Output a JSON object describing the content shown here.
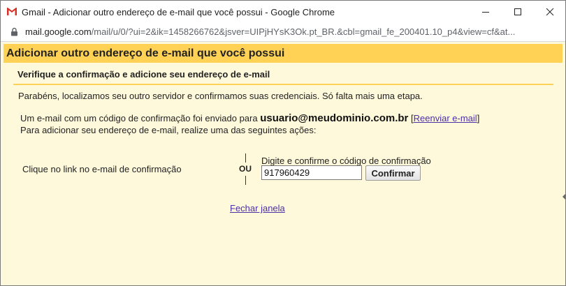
{
  "window": {
    "title": "Gmail - Adicionar outro endereço de e-mail que você possui - Google Chrome",
    "url_host": "mail.google.com",
    "url_path": "/mail/u/0/?ui=2&ik=1458266762&jsver=UIPjHYsK3Ok.pt_BR.&cbl=gmail_fe_200401.10_p4&view=cf&at..."
  },
  "icons": {
    "app": "gmail-icon",
    "lock": "lock-icon",
    "minimize": "minimize-icon",
    "maximize": "maximize-icon",
    "close": "close-icon"
  },
  "page": {
    "title": "Adicionar outro endereço de e-mail que você possui",
    "subtitle": "Verifique a confirmação e adicione seu endereço de e-mail",
    "success_text": "Parabéns, localizamos seu outro servidor e confirmamos suas credenciais. Só falta mais uma etapa.",
    "sent_text": "Um e-mail com um código de confirmação foi enviado para",
    "email": "usuario@meudominio.com.br",
    "resend_open": "[",
    "resend_link": "Reenviar e-mail",
    "resend_close": "]",
    "instructions": "Para adicionar seu endereço de e-mail, realize uma das seguintes ações:",
    "option_link_text": "Clique no link no e-mail de confirmação",
    "or_label": "OU",
    "code_label": "Digite e confirme o código de confirmação",
    "code_value": "917960429",
    "confirm_label": "Confirmar",
    "close_link": "Fechar janela"
  },
  "colors": {
    "header_bg": "#ffd255",
    "page_bg": "#fff9dc",
    "link": "#4b2fa6"
  }
}
